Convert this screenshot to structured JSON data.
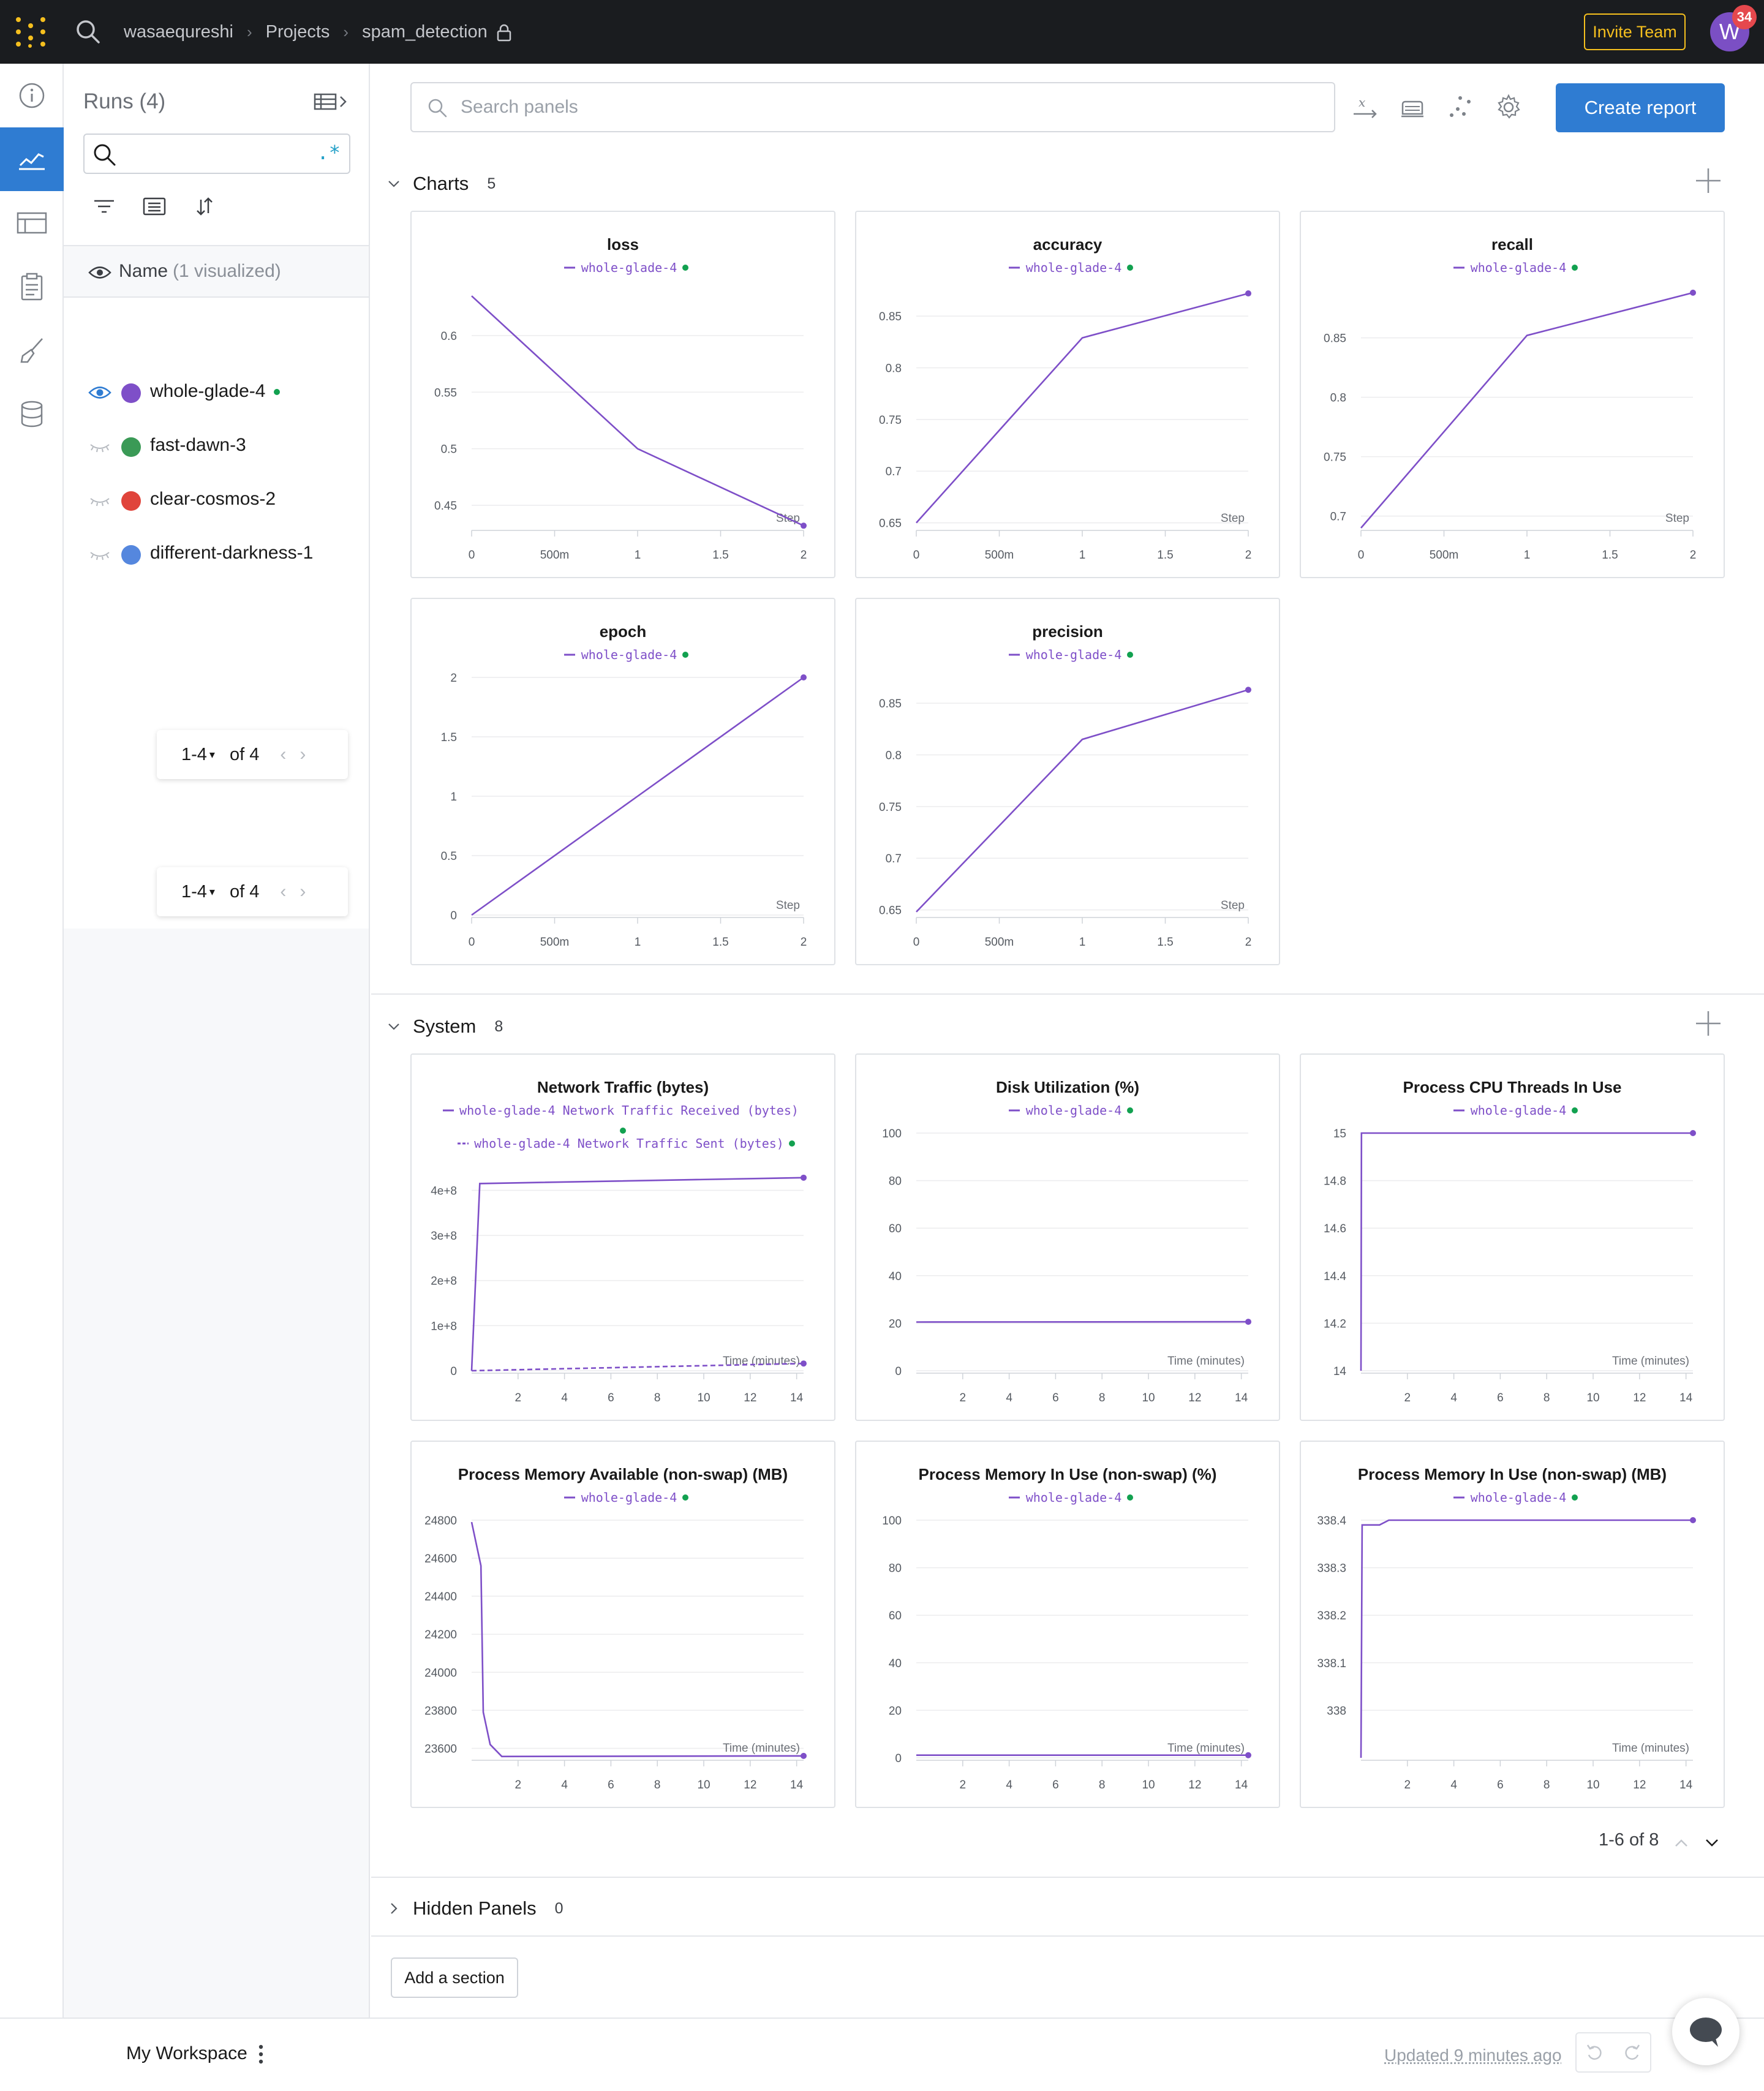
{
  "header": {
    "breadcrumbs": [
      "wasaequreshi",
      "Projects",
      "spam_detection"
    ],
    "invite_label": "Invite Team",
    "avatar_initial": "W",
    "notification_count": "34"
  },
  "rail": {
    "items": [
      "info-icon",
      "charts-icon",
      "table-icon",
      "reports-icon",
      "sweeps-icon",
      "artifacts-icon"
    ],
    "active_index": 1
  },
  "runs": {
    "title": "Runs (4)",
    "regex_label": ".*",
    "column_name": "Name",
    "column_note": "(1 visualized)",
    "items": [
      {
        "name": "whole-glade-4",
        "color": "#7e4fc8",
        "visible": true,
        "live": true
      },
      {
        "name": "fast-dawn-3",
        "color": "#3a9a56",
        "visible": false,
        "live": false
      },
      {
        "name": "clear-cosmos-2",
        "color": "#e0443b",
        "visible": false,
        "live": false
      },
      {
        "name": "different-darkness-1",
        "color": "#5587de",
        "visible": false,
        "live": false
      }
    ],
    "pager": {
      "range": "1-4",
      "of": "of 4"
    }
  },
  "toolbar": {
    "search_placeholder": "Search panels",
    "create_report_label": "Create report"
  },
  "sections": {
    "charts": {
      "title": "Charts",
      "count": "5"
    },
    "system": {
      "title": "System",
      "count": "8"
    },
    "hidden": {
      "title": "Hidden Panels",
      "count": "0"
    }
  },
  "system_paging": "1-6 of 8",
  "add_section_label": "Add a section",
  "footer": {
    "workspace": "My Workspace",
    "updated": "Updated 9 minutes ago"
  },
  "colors": {
    "series": "#7e4fc8",
    "accent": "#2f7cd2",
    "live": "#12a150"
  },
  "chart_data": [
    {
      "id": "loss",
      "type": "line",
      "title": "loss",
      "xlabel": "Step",
      "legend": [
        {
          "label": "whole-glade-4",
          "dashed": false
        }
      ],
      "xlim": [
        0,
        2
      ],
      "ylim": [
        0.43,
        0.64
      ],
      "xticks": [
        {
          "v": 0,
          "l": "0"
        },
        {
          "v": 0.5,
          "l": "500m"
        },
        {
          "v": 1,
          "l": "1"
        },
        {
          "v": 1.5,
          "l": "1.5"
        },
        {
          "v": 2,
          "l": "2"
        }
      ],
      "yticks": [
        {
          "v": 0.45,
          "l": "0.45"
        },
        {
          "v": 0.5,
          "l": "0.5"
        },
        {
          "v": 0.55,
          "l": "0.55"
        },
        {
          "v": 0.6,
          "l": "0.6"
        }
      ],
      "series": [
        {
          "x": [
            0,
            1,
            2
          ],
          "y": [
            0.635,
            0.5,
            0.432
          ],
          "dashed": false
        }
      ]
    },
    {
      "id": "accuracy",
      "type": "line",
      "title": "accuracy",
      "xlabel": "Step",
      "legend": [
        {
          "label": "whole-glade-4",
          "dashed": false
        }
      ],
      "xlim": [
        0,
        2
      ],
      "ylim": [
        0.645,
        0.875
      ],
      "xticks": [
        {
          "v": 0,
          "l": "0"
        },
        {
          "v": 0.5,
          "l": "500m"
        },
        {
          "v": 1,
          "l": "1"
        },
        {
          "v": 1.5,
          "l": "1.5"
        },
        {
          "v": 2,
          "l": "2"
        }
      ],
      "yticks": [
        {
          "v": 0.65,
          "l": "0.65"
        },
        {
          "v": 0.7,
          "l": "0.7"
        },
        {
          "v": 0.75,
          "l": "0.75"
        },
        {
          "v": 0.8,
          "l": "0.8"
        },
        {
          "v": 0.85,
          "l": "0.85"
        }
      ],
      "series": [
        {
          "x": [
            0,
            1,
            2
          ],
          "y": [
            0.65,
            0.829,
            0.872
          ],
          "dashed": false
        }
      ]
    },
    {
      "id": "recall",
      "type": "line",
      "title": "recall",
      "xlabel": "Step",
      "legend": [
        {
          "label": "whole-glade-4",
          "dashed": false
        }
      ],
      "xlim": [
        0,
        2
      ],
      "ylim": [
        0.69,
        0.89
      ],
      "xticks": [
        {
          "v": 0,
          "l": "0"
        },
        {
          "v": 0.5,
          "l": "500m"
        },
        {
          "v": 1,
          "l": "1"
        },
        {
          "v": 1.5,
          "l": "1.5"
        },
        {
          "v": 2,
          "l": "2"
        }
      ],
      "yticks": [
        {
          "v": 0.7,
          "l": "0.7"
        },
        {
          "v": 0.75,
          "l": "0.75"
        },
        {
          "v": 0.8,
          "l": "0.8"
        },
        {
          "v": 0.85,
          "l": "0.85"
        }
      ],
      "series": [
        {
          "x": [
            0,
            1,
            2
          ],
          "y": [
            0.69,
            0.852,
            0.888
          ],
          "dashed": false
        }
      ]
    },
    {
      "id": "epoch",
      "type": "line",
      "title": "epoch",
      "xlabel": "Step",
      "legend": [
        {
          "label": "whole-glade-4",
          "dashed": false
        }
      ],
      "xlim": [
        0,
        2
      ],
      "ylim": [
        0,
        2
      ],
      "xticks": [
        {
          "v": 0,
          "l": "0"
        },
        {
          "v": 0.5,
          "l": "500m"
        },
        {
          "v": 1,
          "l": "1"
        },
        {
          "v": 1.5,
          "l": "1.5"
        },
        {
          "v": 2,
          "l": "2"
        }
      ],
      "yticks": [
        {
          "v": 0,
          "l": "0"
        },
        {
          "v": 0.5,
          "l": "0.5"
        },
        {
          "v": 1,
          "l": "1"
        },
        {
          "v": 1.5,
          "l": "1.5"
        },
        {
          "v": 2,
          "l": "2"
        }
      ],
      "series": [
        {
          "x": [
            0,
            1,
            2
          ],
          "y": [
            0,
            1,
            2
          ],
          "dashed": false
        }
      ]
    },
    {
      "id": "precision",
      "type": "line",
      "title": "precision",
      "xlabel": "Step",
      "legend": [
        {
          "label": "whole-glade-4",
          "dashed": false
        }
      ],
      "xlim": [
        0,
        2
      ],
      "ylim": [
        0.645,
        0.875
      ],
      "xticks": [
        {
          "v": 0,
          "l": "0"
        },
        {
          "v": 0.5,
          "l": "500m"
        },
        {
          "v": 1,
          "l": "1"
        },
        {
          "v": 1.5,
          "l": "1.5"
        },
        {
          "v": 2,
          "l": "2"
        }
      ],
      "yticks": [
        {
          "v": 0.65,
          "l": "0.65"
        },
        {
          "v": 0.7,
          "l": "0.7"
        },
        {
          "v": 0.75,
          "l": "0.75"
        },
        {
          "v": 0.8,
          "l": "0.8"
        },
        {
          "v": 0.85,
          "l": "0.85"
        }
      ],
      "series": [
        {
          "x": [
            0,
            1,
            2
          ],
          "y": [
            0.648,
            0.815,
            0.863
          ],
          "dashed": false
        }
      ]
    },
    {
      "id": "network",
      "type": "line",
      "title": "Network Traffic (bytes)",
      "xlabel": "Time (minutes)",
      "legend": [
        {
          "label": "whole-glade-4 Network Traffic Received (bytes)",
          "dashed": false
        },
        {
          "label": "whole-glade-4 Network Traffic Sent (bytes)",
          "dashed": true
        }
      ],
      "xlim": [
        0,
        14.3
      ],
      "ylim": [
        0,
        440000000
      ],
      "xticks": [
        {
          "v": 2,
          "l": "2"
        },
        {
          "v": 4,
          "l": "4"
        },
        {
          "v": 6,
          "l": "6"
        },
        {
          "v": 8,
          "l": "8"
        },
        {
          "v": 10,
          "l": "10"
        },
        {
          "v": 12,
          "l": "12"
        },
        {
          "v": 14,
          "l": "14"
        }
      ],
      "yticks": [
        {
          "v": 0,
          "l": "0"
        },
        {
          "v": 100000000,
          "l": "1e+8"
        },
        {
          "v": 200000000,
          "l": "2e+8"
        },
        {
          "v": 300000000,
          "l": "3e+8"
        },
        {
          "v": 400000000,
          "l": "4e+8"
        }
      ],
      "series": [
        {
          "x": [
            0,
            0.35,
            14.3
          ],
          "y": [
            0,
            415000000,
            428000000
          ],
          "dashed": false
        },
        {
          "x": [
            0,
            14.3
          ],
          "y": [
            0,
            16000000
          ],
          "dashed": true
        }
      ]
    },
    {
      "id": "disk",
      "type": "line",
      "title": "Disk Utilization (%)",
      "xlabel": "Time (minutes)",
      "legend": [
        {
          "label": "whole-glade-4",
          "dashed": false
        }
      ],
      "xlim": [
        0,
        14.3
      ],
      "ylim": [
        0,
        100
      ],
      "xticks": [
        {
          "v": 2,
          "l": "2"
        },
        {
          "v": 4,
          "l": "4"
        },
        {
          "v": 6,
          "l": "6"
        },
        {
          "v": 8,
          "l": "8"
        },
        {
          "v": 10,
          "l": "10"
        },
        {
          "v": 12,
          "l": "12"
        },
        {
          "v": 14,
          "l": "14"
        }
      ],
      "yticks": [
        {
          "v": 0,
          "l": "0"
        },
        {
          "v": 20,
          "l": "20"
        },
        {
          "v": 40,
          "l": "40"
        },
        {
          "v": 60,
          "l": "60"
        },
        {
          "v": 80,
          "l": "80"
        },
        {
          "v": 100,
          "l": "100"
        }
      ],
      "series": [
        {
          "x": [
            0,
            14.3
          ],
          "y": [
            20.5,
            20.6
          ],
          "dashed": false
        }
      ]
    },
    {
      "id": "cpu_threads",
      "type": "line",
      "title": "Process CPU Threads In Use",
      "xlabel": "Time (minutes)",
      "legend": [
        {
          "label": "whole-glade-4",
          "dashed": false
        }
      ],
      "xlim": [
        0,
        14.3
      ],
      "ylim": [
        14,
        15
      ],
      "xticks": [
        {
          "v": 2,
          "l": "2"
        },
        {
          "v": 4,
          "l": "4"
        },
        {
          "v": 6,
          "l": "6"
        },
        {
          "v": 8,
          "l": "8"
        },
        {
          "v": 10,
          "l": "10"
        },
        {
          "v": 12,
          "l": "12"
        },
        {
          "v": 14,
          "l": "14"
        }
      ],
      "yticks": [
        {
          "v": 14,
          "l": "14"
        },
        {
          "v": 14.2,
          "l": "14.2"
        },
        {
          "v": 14.4,
          "l": "14.4"
        },
        {
          "v": 14.6,
          "l": "14.6"
        },
        {
          "v": 14.8,
          "l": "14.8"
        },
        {
          "v": 15,
          "l": "15"
        }
      ],
      "series": [
        {
          "x": [
            0,
            0.02,
            14.3
          ],
          "y": [
            14,
            15,
            15
          ],
          "dashed": false
        }
      ]
    },
    {
      "id": "mem_available",
      "type": "line",
      "title": "Process Memory Available (non-swap) (MB)",
      "xlabel": "Time (minutes)",
      "legend": [
        {
          "label": "whole-glade-4",
          "dashed": false
        }
      ],
      "xlim": [
        0,
        14.3
      ],
      "ylim": [
        23550,
        24800
      ],
      "xticks": [
        {
          "v": 2,
          "l": "2"
        },
        {
          "v": 4,
          "l": "4"
        },
        {
          "v": 6,
          "l": "6"
        },
        {
          "v": 8,
          "l": "8"
        },
        {
          "v": 10,
          "l": "10"
        },
        {
          "v": 12,
          "l": "12"
        },
        {
          "v": 14,
          "l": "14"
        }
      ],
      "yticks": [
        {
          "v": 23600,
          "l": "23600"
        },
        {
          "v": 23800,
          "l": "23800"
        },
        {
          "v": 24000,
          "l": "24000"
        },
        {
          "v": 24200,
          "l": "24200"
        },
        {
          "v": 24400,
          "l": "24400"
        },
        {
          "v": 24600,
          "l": "24600"
        },
        {
          "v": 24800,
          "l": "24800"
        }
      ],
      "series": [
        {
          "x": [
            0,
            0.4,
            0.5,
            0.8,
            1.3,
            14.3
          ],
          "y": [
            24790,
            24560,
            23790,
            23620,
            23557,
            23560
          ],
          "dashed": false
        }
      ]
    },
    {
      "id": "mem_in_use_pct",
      "type": "line",
      "title": "Process Memory In Use (non-swap) (%)",
      "xlabel": "Time (minutes)",
      "legend": [
        {
          "label": "whole-glade-4",
          "dashed": false
        }
      ],
      "xlim": [
        0,
        14.3
      ],
      "ylim": [
        0,
        100
      ],
      "xticks": [
        {
          "v": 2,
          "l": "2"
        },
        {
          "v": 4,
          "l": "4"
        },
        {
          "v": 6,
          "l": "6"
        },
        {
          "v": 8,
          "l": "8"
        },
        {
          "v": 10,
          "l": "10"
        },
        {
          "v": 12,
          "l": "12"
        },
        {
          "v": 14,
          "l": "14"
        }
      ],
      "yticks": [
        {
          "v": 0,
          "l": "0"
        },
        {
          "v": 20,
          "l": "20"
        },
        {
          "v": 40,
          "l": "40"
        },
        {
          "v": 60,
          "l": "60"
        },
        {
          "v": 80,
          "l": "80"
        },
        {
          "v": 100,
          "l": "100"
        }
      ],
      "series": [
        {
          "x": [
            0,
            14.3
          ],
          "y": [
            1.1,
            1.1
          ],
          "dashed": false
        }
      ]
    },
    {
      "id": "mem_in_use_mb",
      "type": "line",
      "title": "Process Memory In Use (non-swap) (MB)",
      "xlabel": "Time (minutes)",
      "legend": [
        {
          "label": "whole-glade-4",
          "dashed": false
        }
      ],
      "xlim": [
        0,
        14.3
      ],
      "ylim": [
        337.9,
        338.4
      ],
      "xticks": [
        {
          "v": 2,
          "l": "2"
        },
        {
          "v": 4,
          "l": "4"
        },
        {
          "v": 6,
          "l": "6"
        },
        {
          "v": 8,
          "l": "8"
        },
        {
          "v": 10,
          "l": "10"
        },
        {
          "v": 12,
          "l": "12"
        },
        {
          "v": 14,
          "l": "14"
        }
      ],
      "yticks": [
        {
          "v": 338,
          "l": "338"
        },
        {
          "v": 338.1,
          "l": "338.1"
        },
        {
          "v": 338.2,
          "l": "338.2"
        },
        {
          "v": 338.3,
          "l": "338.3"
        },
        {
          "v": 338.4,
          "l": "338.4"
        }
      ],
      "series": [
        {
          "x": [
            0,
            0.05,
            0.8,
            1.2,
            14.3
          ],
          "y": [
            337.9,
            338.39,
            338.39,
            338.4,
            338.4
          ],
          "dashed": false
        }
      ]
    }
  ]
}
